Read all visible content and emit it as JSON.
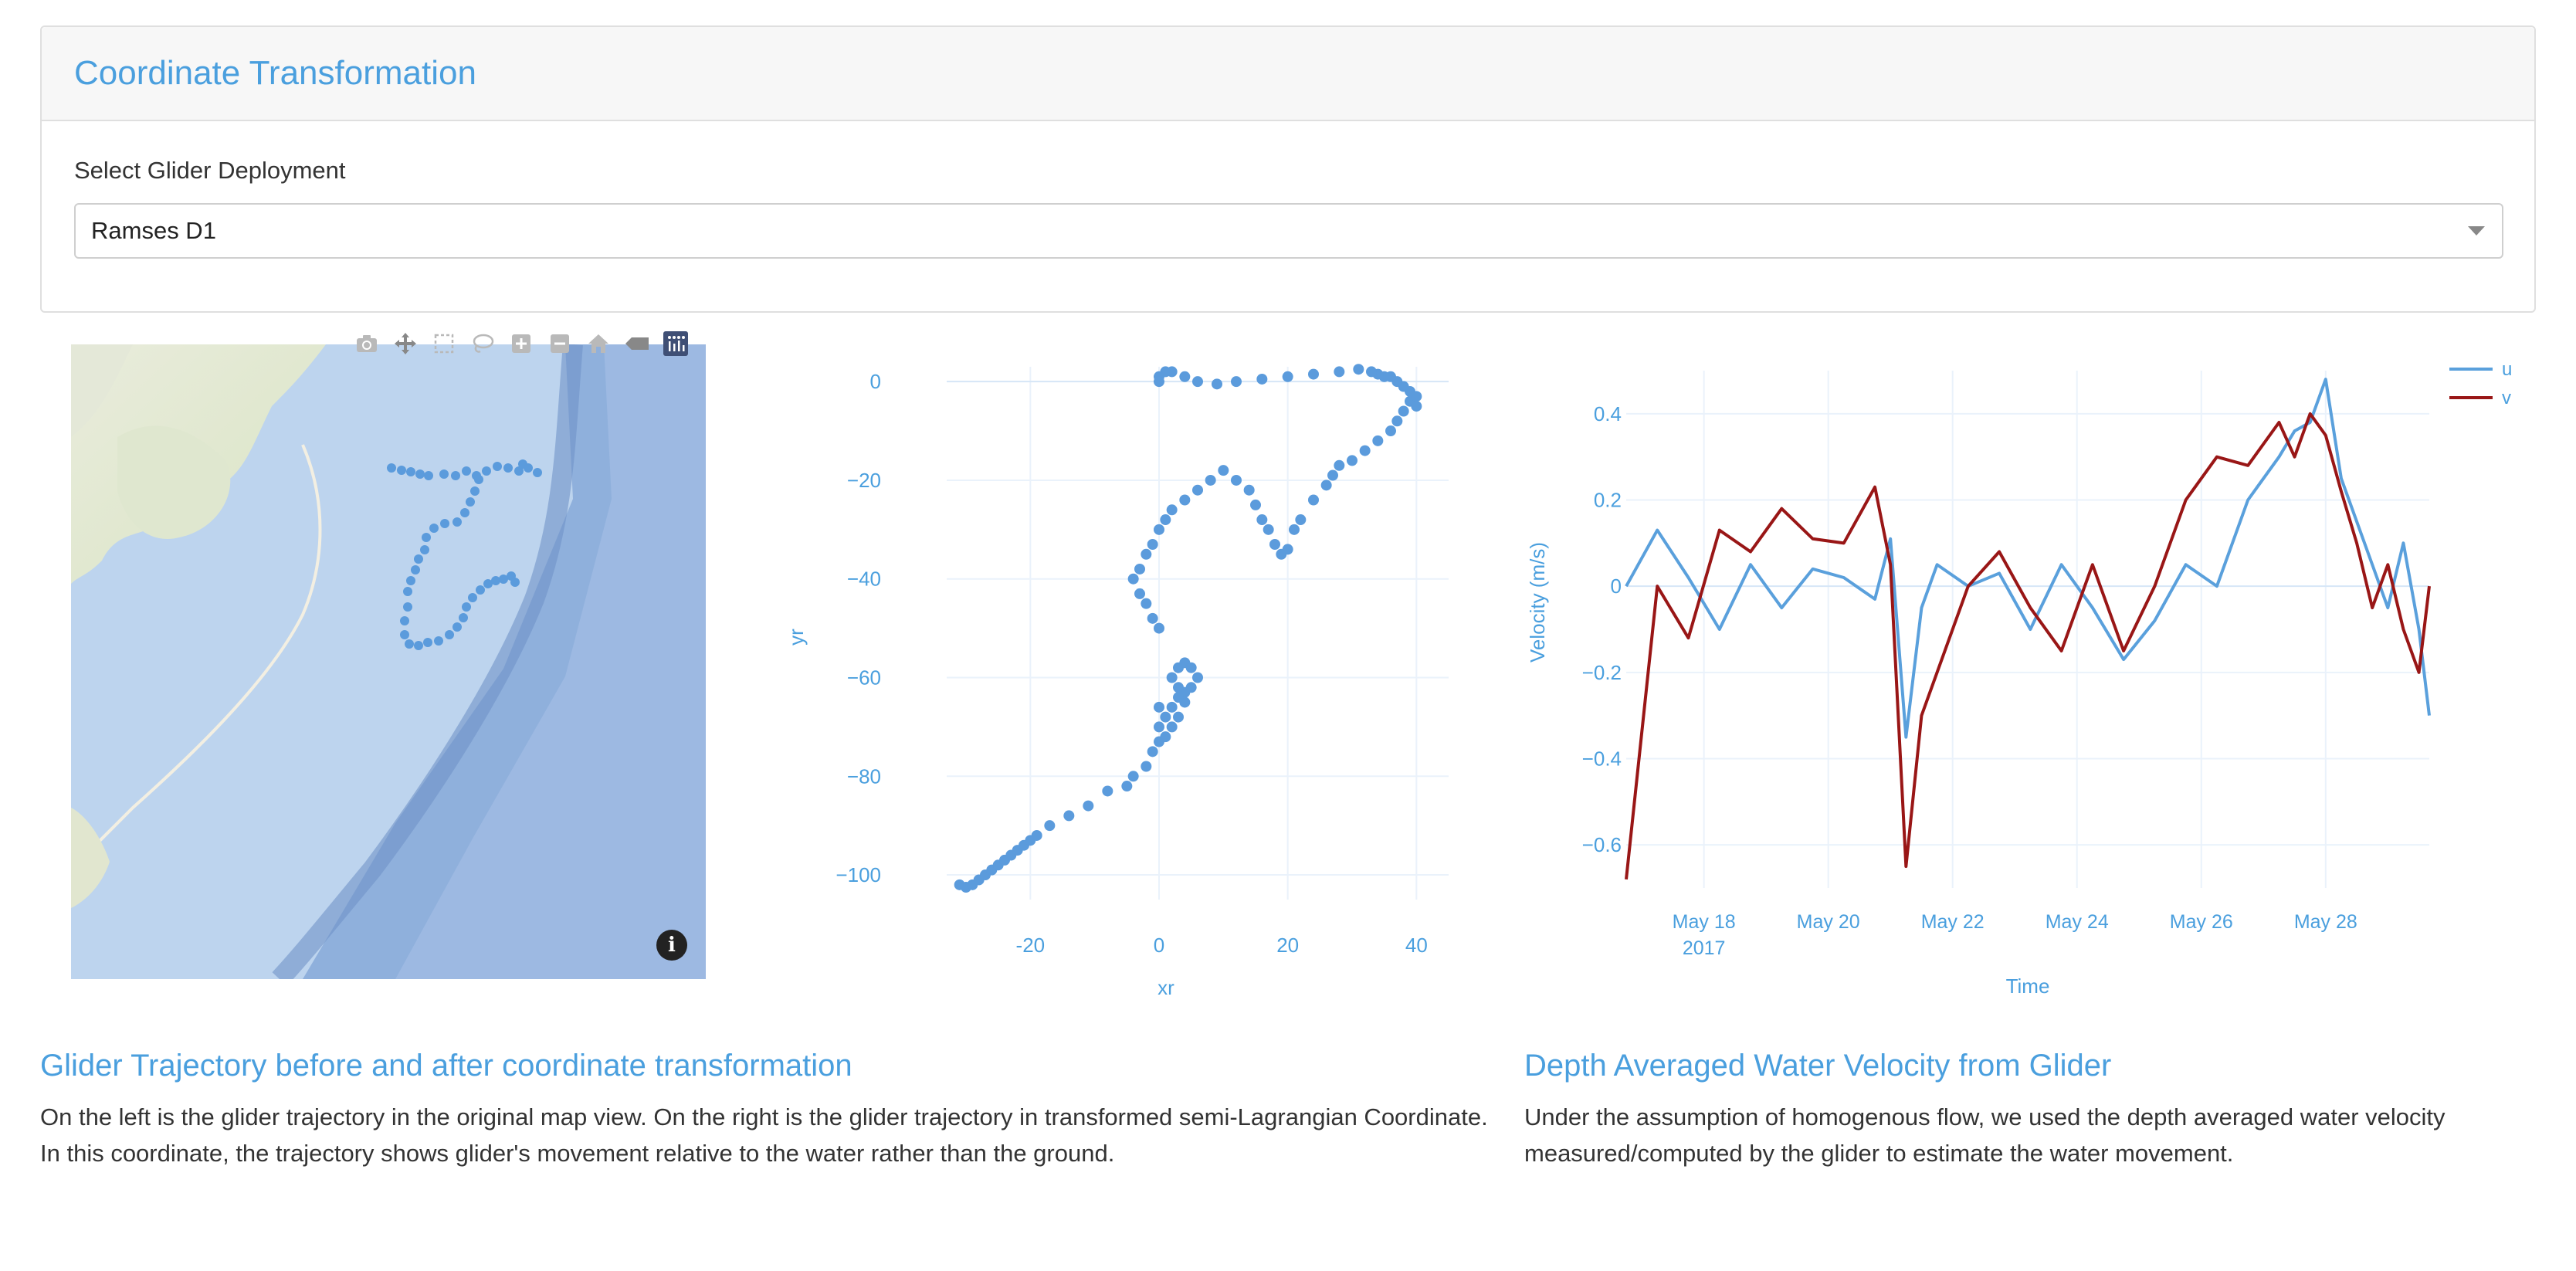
{
  "card": {
    "title": "Coordinate Transformation",
    "select_label": "Select Glider Deployment",
    "select_value": "Ramses D1"
  },
  "modebar": {
    "icons": [
      "camera-icon",
      "pan-icon",
      "box-select-icon",
      "lasso-icon",
      "zoom-in-icon",
      "zoom-out-icon",
      "home-icon",
      "hover-icon",
      "plotly-logo-icon"
    ]
  },
  "colors": {
    "accent": "#4a9fde",
    "u_series": "#5aa0dc",
    "v_series": "#991616",
    "points": "#5b9bdc"
  },
  "chart_data": [
    {
      "type": "scatter",
      "xlabel": "xr",
      "ylabel": "yr",
      "xticks": [
        "-20",
        "0",
        "20",
        "40"
      ],
      "yticks": [
        "0",
        "-20",
        "-40",
        "-60",
        "-80",
        "-100"
      ],
      "xlim": [
        -33,
        45
      ],
      "ylim": [
        -105,
        3
      ],
      "x": [
        -31,
        -30,
        -29,
        -28,
        -27,
        -26,
        -25,
        -24,
        -23,
        -22,
        -21,
        -20,
        -19,
        -17,
        -14,
        -11,
        -8,
        -5,
        -4,
        -2,
        -1,
        0,
        1,
        2,
        3,
        4,
        4,
        3,
        2,
        3,
        4,
        5,
        6,
        5,
        3,
        2,
        1,
        0,
        0,
        0,
        -1,
        -2,
        -3,
        -4,
        -3,
        -2,
        -1,
        0,
        1,
        2,
        4,
        6,
        8,
        10,
        12,
        14,
        15,
        16,
        17,
        18,
        19,
        20,
        21,
        22,
        24,
        26,
        27,
        28,
        30,
        32,
        34,
        36,
        37,
        38,
        39,
        40,
        40,
        39,
        38,
        37,
        36,
        35,
        34,
        33,
        31,
        28,
        24,
        20,
        16,
        12,
        9,
        6,
        4,
        2,
        1,
        0,
        0
      ],
      "y": [
        -102,
        -102.5,
        -102,
        -101,
        -100,
        -99,
        -98,
        -97,
        -96,
        -95,
        -94,
        -93,
        -92,
        -90,
        -88,
        -86,
        -83,
        -82,
        -80,
        -78,
        -75,
        -73,
        -72,
        -70,
        -68,
        -65,
        -63,
        -62,
        -60,
        -58,
        -57,
        -58,
        -60,
        -62,
        -64,
        -66,
        -68,
        -70,
        -66,
        -50,
        -48,
        -45,
        -43,
        -40,
        -38,
        -35,
        -33,
        -30,
        -28,
        -26,
        -24,
        -22,
        -20,
        -18,
        -20,
        -22,
        -25,
        -28,
        -30,
        -33,
        -35,
        -34,
        -30,
        -28,
        -24,
        -21,
        -19,
        -17,
        -16,
        -14,
        -12,
        -10,
        -8,
        -6,
        -4,
        -5,
        -3,
        -2,
        -1,
        0,
        1,
        1,
        1.5,
        2,
        2.5,
        2,
        1.5,
        1,
        0.5,
        0,
        -0.5,
        0,
        1,
        2,
        2,
        1,
        0,
        0
      ],
      "markers_only": true
    },
    {
      "type": "line",
      "xlabel": "Time",
      "ylabel": "Velocity (m/s)",
      "xticks": [
        "May 18",
        "May 20",
        "May 22",
        "May 24",
        "May 26",
        "May 28"
      ],
      "xsub": "2017",
      "yticks": [
        "0.4",
        "0.2",
        "0",
        "−0.2",
        "−0.4",
        "−0.6"
      ],
      "xlim": [
        "2017-05-16T18:00",
        "2017-05-29T16:00"
      ],
      "ylim": [
        -0.7,
        0.5
      ],
      "legend_position": "top-right",
      "dates": [
        "2017-05-16T18:00",
        "2017-05-17T06:00",
        "2017-05-17T18:00",
        "2017-05-18T06:00",
        "2017-05-18T18:00",
        "2017-05-19T06:00",
        "2017-05-19T18:00",
        "2017-05-20T06:00",
        "2017-05-20T18:00",
        "2017-05-21T00:00",
        "2017-05-21T06:00",
        "2017-05-21T12:00",
        "2017-05-21T18:00",
        "2017-05-22T06:00",
        "2017-05-22T18:00",
        "2017-05-23T06:00",
        "2017-05-23T18:00",
        "2017-05-24T06:00",
        "2017-05-24T18:00",
        "2017-05-25T06:00",
        "2017-05-25T18:00",
        "2017-05-26T06:00",
        "2017-05-26T18:00",
        "2017-05-27T06:00",
        "2017-05-27T12:00",
        "2017-05-27T18:00",
        "2017-05-28T00:00",
        "2017-05-28T06:00",
        "2017-05-28T12:00",
        "2017-05-28T18:00",
        "2017-05-29T00:00",
        "2017-05-29T06:00",
        "2017-05-29T12:00",
        "2017-05-29T16:00"
      ],
      "series": [
        {
          "name": "u",
          "values": [
            0,
            0.13,
            0.02,
            -0.1,
            0.05,
            -0.05,
            0.04,
            0.02,
            -0.03,
            0.11,
            -0.35,
            -0.05,
            0.05,
            0.0,
            0.03,
            -0.1,
            0.05,
            -0.05,
            -0.17,
            -0.08,
            0.05,
            0.0,
            0.2,
            0.3,
            0.36,
            0.38,
            0.48,
            0.25,
            0.15,
            0.05,
            -0.05,
            0.1,
            -0.1,
            -0.3
          ]
        },
        {
          "name": "v",
          "values": [
            -0.68,
            0.0,
            -0.12,
            0.13,
            0.08,
            0.18,
            0.11,
            0.1,
            0.23,
            0.05,
            -0.65,
            -0.3,
            -0.2,
            0.0,
            0.08,
            -0.05,
            -0.15,
            0.05,
            -0.15,
            0.0,
            0.2,
            0.3,
            0.28,
            0.38,
            0.3,
            0.4,
            0.35,
            0.22,
            0.1,
            -0.05,
            0.05,
            -0.1,
            -0.2,
            0.0
          ]
        }
      ]
    }
  ],
  "sections": {
    "left": {
      "title": "Glider Trajectory before and after coordinate transformation",
      "text": "On the left is the glider trajectory in the original map view. On the right is the glider trajectory in transformed semi-Lagrangian Coordinate. In this coordinate, the trajectory shows glider's movement relative to the water rather than the ground."
    },
    "right": {
      "title": "Depth Averaged Water Velocity from Glider",
      "text": "Under the assumption of homogenous flow, we used the depth averaged water velocity measured/computed by the glider to estimate the water movement."
    }
  }
}
